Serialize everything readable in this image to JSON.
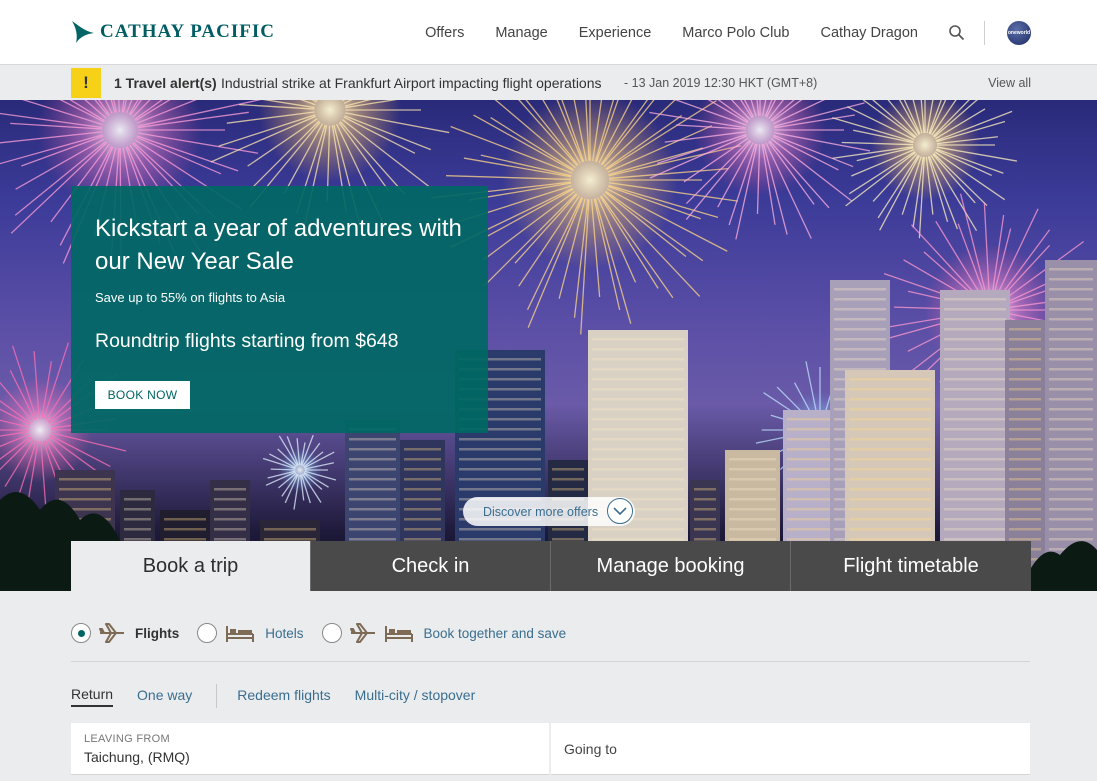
{
  "header": {
    "logo_text": "CATHAY PACIFIC",
    "nav": [
      "Offers",
      "Manage",
      "Experience",
      "Marco Polo Club",
      "Cathay Dragon"
    ],
    "oneworld_label": "oneworld"
  },
  "alert": {
    "badge": "!",
    "count": "1 Travel alert(s)",
    "message": "Industrial strike at Frankfurt Airport impacting flight operations",
    "date": "- 13 Jan 2019 12:30 HKT (GMT+8)",
    "view_all": "View all"
  },
  "promo": {
    "title": "Kickstart a year of adventures with our New Year Sale",
    "subtitle": "Save up to 55% on flights to Asia",
    "price": "Roundtrip flights starting from $648",
    "button": "BOOK NOW"
  },
  "discover": "Discover more offers",
  "tabs": [
    {
      "label": "Book a trip",
      "active": true
    },
    {
      "label": "Check in",
      "active": false
    },
    {
      "label": "Manage booking",
      "active": false
    },
    {
      "label": "Flight timetable",
      "active": false
    }
  ],
  "booking_types": [
    {
      "label": "Flights",
      "selected": true
    },
    {
      "label": "Hotels",
      "selected": false
    },
    {
      "label": "Book together and save",
      "selected": false
    }
  ],
  "trip_types": [
    {
      "label": "Return",
      "active": true
    },
    {
      "label": "One way",
      "active": false
    },
    {
      "label": "Redeem flights",
      "active": false
    },
    {
      "label": "Multi-city / stopover",
      "active": false
    }
  ],
  "fields": {
    "leaving_label": "LEAVING FROM",
    "leaving_value": "Taichung, (RMQ)",
    "going_placeholder": "Going to"
  },
  "colors": {
    "brand": "#006564",
    "alert": "#f7d117",
    "tab_dark": "#4a4a4a",
    "link": "#3a6e8f"
  }
}
